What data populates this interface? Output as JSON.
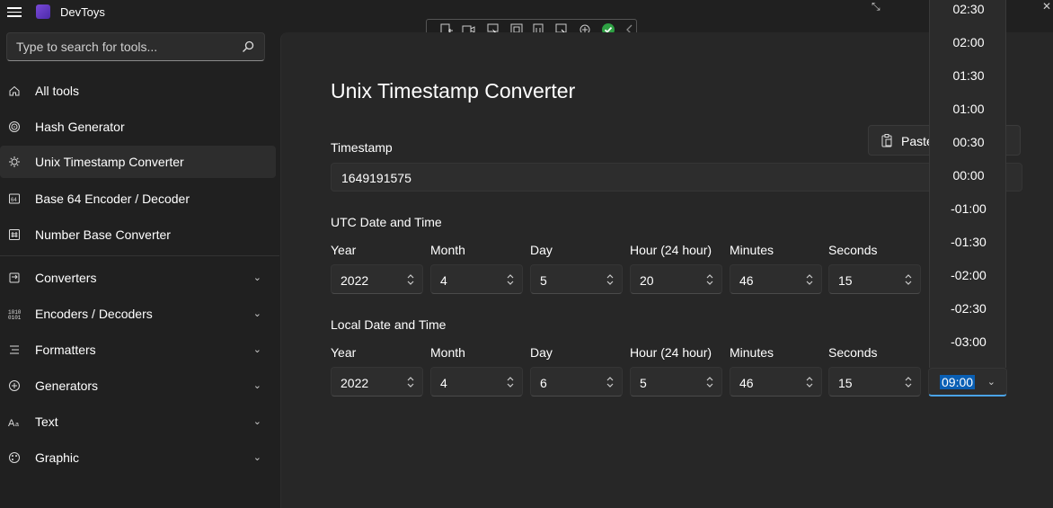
{
  "app": {
    "title": "DevToys"
  },
  "search": {
    "placeholder": "Type to search for tools..."
  },
  "nav": {
    "items": [
      {
        "label": "All tools",
        "icon": "home-icon"
      },
      {
        "label": "Hash Generator",
        "icon": "fingerprint-icon"
      },
      {
        "label": "Unix Timestamp Converter",
        "icon": "sun-clock-icon",
        "selected": true
      },
      {
        "label": "Base 64 Encoder / Decoder",
        "icon": "base64-icon"
      },
      {
        "label": "Number Base Converter",
        "icon": "hash-icon"
      }
    ],
    "groups": [
      {
        "label": "Converters",
        "icon": "converter-icon"
      },
      {
        "label": "Encoders / Decoders",
        "icon": "binary-icon"
      },
      {
        "label": "Formatters",
        "icon": "list-icon"
      },
      {
        "label": "Generators",
        "icon": "generator-icon"
      },
      {
        "label": "Text",
        "icon": "text-icon"
      },
      {
        "label": "Graphic",
        "icon": "palette-icon"
      }
    ]
  },
  "main": {
    "title": "Unix Timestamp Converter",
    "timestamp_label": "Timestamp",
    "timestamp_value": "1649191575",
    "paste_label": "Paste",
    "utc": {
      "title": "UTC Date and Time",
      "fields": [
        "Year",
        "Month",
        "Day",
        "Hour (24 hour)",
        "Minutes",
        "Seconds"
      ],
      "values": [
        "2022",
        "4",
        "5",
        "20",
        "46",
        "15"
      ]
    },
    "local": {
      "title": "Local Date and Time",
      "fields": [
        "Year",
        "Month",
        "Day",
        "Hour (24 hour)",
        "Minutes",
        "Seconds"
      ],
      "values": [
        "2022",
        "4",
        "6",
        "5",
        "46",
        "15"
      ],
      "timezone": "09:00"
    }
  },
  "timezone_dropdown": {
    "options": [
      "02:30",
      "02:00",
      "01:30",
      "01:00",
      "00:30",
      "00:00",
      "-01:00",
      "-01:30",
      "-02:00",
      "-02:30",
      "-03:00"
    ]
  },
  "colors": {
    "accent": "#0a5fb4",
    "focus": "#4aa3e6",
    "background": "#202020",
    "panel": "#272727"
  }
}
